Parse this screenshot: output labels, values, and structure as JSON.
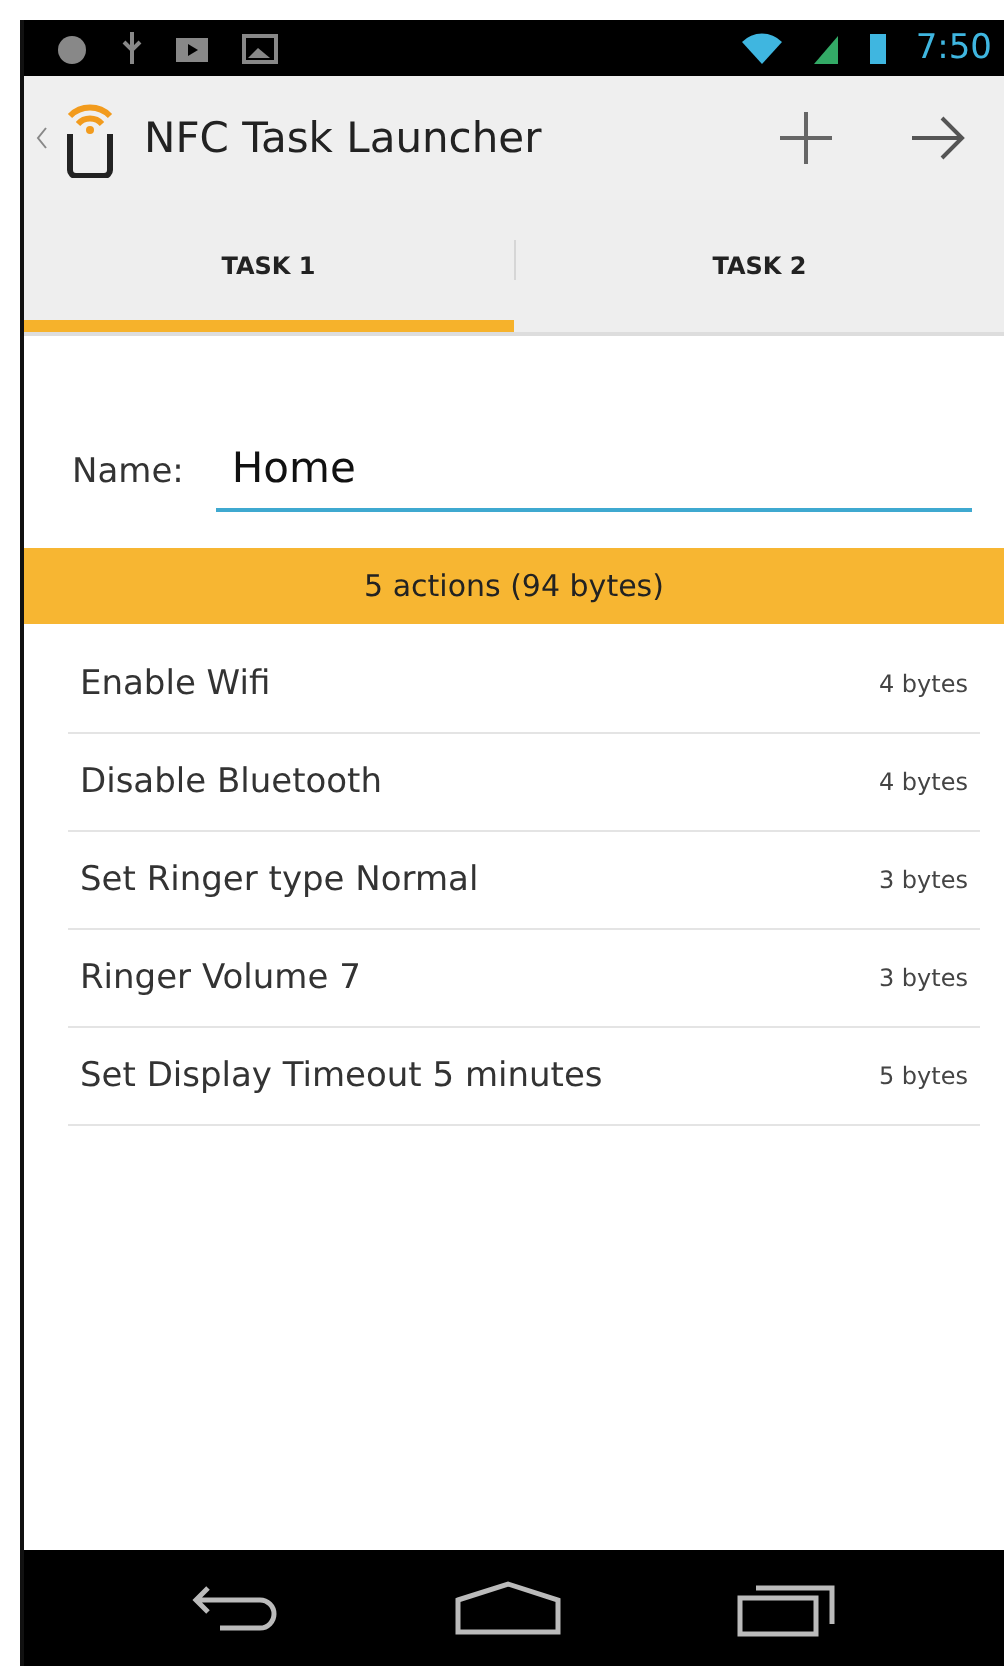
{
  "status_bar": {
    "time": "7:50"
  },
  "action_bar": {
    "title": "NFC Task Launcher"
  },
  "tabs": [
    {
      "label": "TASK 1",
      "selected": true
    },
    {
      "label": "TASK 2",
      "selected": false
    }
  ],
  "name_field": {
    "label": "Name:",
    "value": "Home"
  },
  "summary": "5 actions (94 bytes)",
  "actions": [
    {
      "name": "Enable Wifi",
      "size": "4 bytes"
    },
    {
      "name": "Disable Bluetooth",
      "size": "4 bytes"
    },
    {
      "name": "Set Ringer type Normal",
      "size": "3 bytes"
    },
    {
      "name": "Ringer Volume 7",
      "size": "3 bytes"
    },
    {
      "name": "Set Display Timeout 5 minutes",
      "size": "5 bytes"
    }
  ]
}
